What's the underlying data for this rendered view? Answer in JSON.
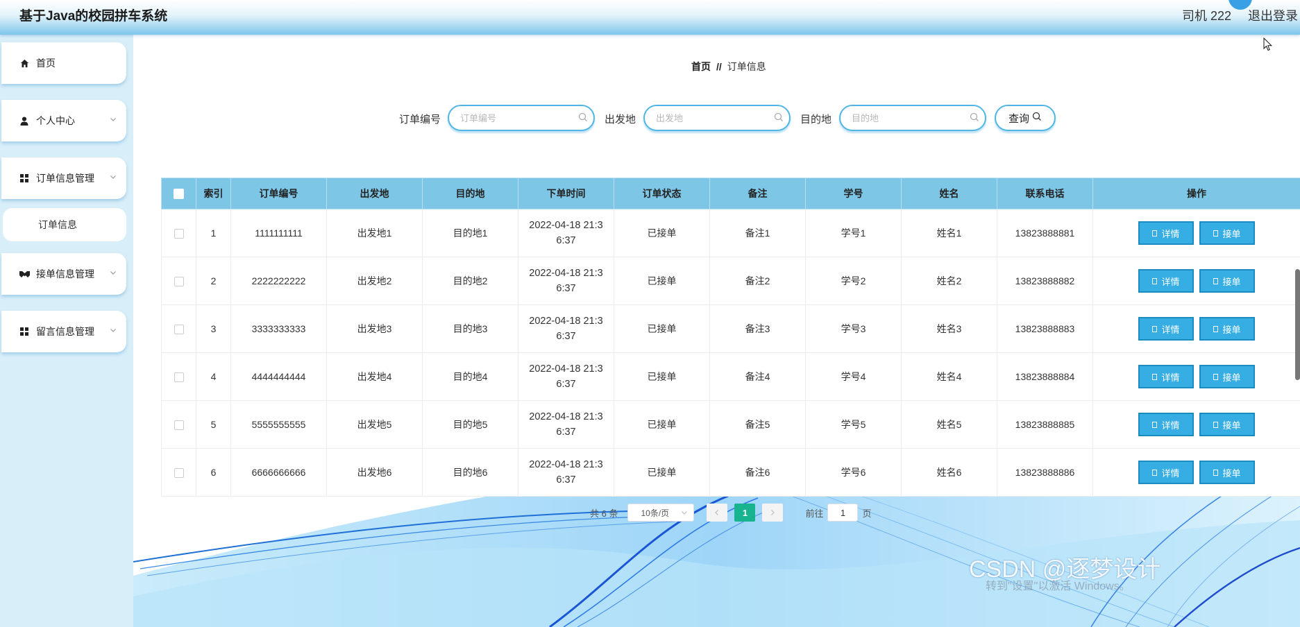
{
  "app": {
    "title": "基于Java的校园拼车系统",
    "user": "司机 222",
    "logout": "退出登录"
  },
  "sidebar": {
    "items": [
      {
        "label": "首页",
        "icon": "home-icon"
      },
      {
        "label": "个人中心",
        "icon": "user-icon"
      },
      {
        "label": "订单信息管理",
        "icon": "grid-icon"
      },
      {
        "label": "接单信息管理",
        "icon": "handshake-icon"
      },
      {
        "label": "留言信息管理",
        "icon": "grid-icon"
      }
    ],
    "sub_item": "订单信息"
  },
  "breadcrumb": {
    "home": "首页",
    "separator": "//",
    "current": "订单信息"
  },
  "search": {
    "order_no_label": "订单编号",
    "order_no_placeholder": "订单编号",
    "origin_label": "出发地",
    "origin_placeholder": "出发地",
    "dest_label": "目的地",
    "dest_placeholder": "目的地",
    "button": "查询"
  },
  "table": {
    "headers": [
      "索引",
      "订单编号",
      "出发地",
      "目的地",
      "下单时间",
      "订单状态",
      "备注",
      "学号",
      "姓名",
      "联系电话",
      "操作"
    ],
    "rows": [
      {
        "index": "1",
        "order_no": "1111111111",
        "origin": "出发地1",
        "dest": "目的地1",
        "time_line1": "2022-04-18 21:3",
        "time_line2": "6:37",
        "status": "已接单",
        "remark": "备注1",
        "student_no": "学号1",
        "name": "姓名1",
        "phone": "13823888881"
      },
      {
        "index": "2",
        "order_no": "2222222222",
        "origin": "出发地2",
        "dest": "目的地2",
        "time_line1": "2022-04-18 21:3",
        "time_line2": "6:37",
        "status": "已接单",
        "remark": "备注2",
        "student_no": "学号2",
        "name": "姓名2",
        "phone": "13823888882"
      },
      {
        "index": "3",
        "order_no": "3333333333",
        "origin": "出发地3",
        "dest": "目的地3",
        "time_line1": "2022-04-18 21:3",
        "time_line2": "6:37",
        "status": "已接单",
        "remark": "备注3",
        "student_no": "学号3",
        "name": "姓名3",
        "phone": "13823888883"
      },
      {
        "index": "4",
        "order_no": "4444444444",
        "origin": "出发地4",
        "dest": "目的地4",
        "time_line1": "2022-04-18 21:3",
        "time_line2": "6:37",
        "status": "已接单",
        "remark": "备注4",
        "student_no": "学号4",
        "name": "姓名4",
        "phone": "13823888884"
      },
      {
        "index": "5",
        "order_no": "5555555555",
        "origin": "出发地5",
        "dest": "目的地5",
        "time_line1": "2022-04-18 21:3",
        "time_line2": "6:37",
        "status": "已接单",
        "remark": "备注5",
        "student_no": "学号5",
        "name": "姓名5",
        "phone": "13823888885"
      },
      {
        "index": "6",
        "order_no": "6666666666",
        "origin": "出发地6",
        "dest": "目的地6",
        "time_line1": "2022-04-18 21:3",
        "time_line2": "6:37",
        "status": "已接单",
        "remark": "备注6",
        "student_no": "学号6",
        "name": "姓名6",
        "phone": "13823888886"
      }
    ],
    "detail_btn": "详情",
    "accept_btn": "接单"
  },
  "pagination": {
    "total": "共 6 条",
    "page_size": "10条/页",
    "current_page": "1",
    "goto_prefix": "前往",
    "goto_value": "1",
    "goto_suffix": "页"
  },
  "watermark": "CSDN @逐梦设计",
  "os_notice": "转到\"设置\"以激活 Windows。",
  "colors": {
    "header": "#7ec6e6",
    "button": "#37aee3",
    "page_active": "#18b38f",
    "accent": "#4fb6e6"
  }
}
